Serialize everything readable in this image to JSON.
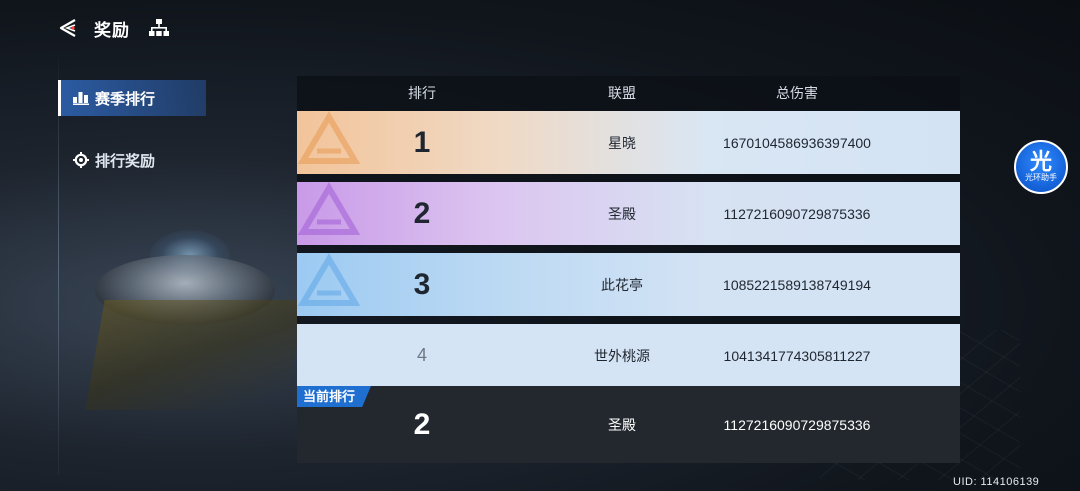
{
  "header": {
    "title": "奖励"
  },
  "sidebar": {
    "items": [
      {
        "label": "赛季排行",
        "active": true
      },
      {
        "label": "排行奖励",
        "active": false
      }
    ]
  },
  "table": {
    "headers": {
      "rank": "排行",
      "guild": "联盟",
      "damage": "总伤害"
    },
    "rows": [
      {
        "rank": "1",
        "guild": "星晓",
        "damage": "1670104586936397400"
      },
      {
        "rank": "2",
        "guild": "圣殿",
        "damage": "1127216090729875336"
      },
      {
        "rank": "3",
        "guild": "此花亭",
        "damage": "1085221589138749194"
      },
      {
        "rank": "4",
        "guild": "世外桃源",
        "damage": "1041341774305811227"
      }
    ],
    "current": {
      "tag": "当前排行",
      "rank": "2",
      "guild": "圣殿",
      "damage": "1127216090729875336"
    }
  },
  "assistant": {
    "glyph": "光",
    "label": "光环助手"
  },
  "footer": {
    "uid": "UID:  114106139"
  },
  "colors": {
    "gold": "#f2c49a",
    "purple": "#c99ae8",
    "blue": "#9ccaf2",
    "accent": "#1f6fd1",
    "active_tab": "#2d5faa"
  }
}
